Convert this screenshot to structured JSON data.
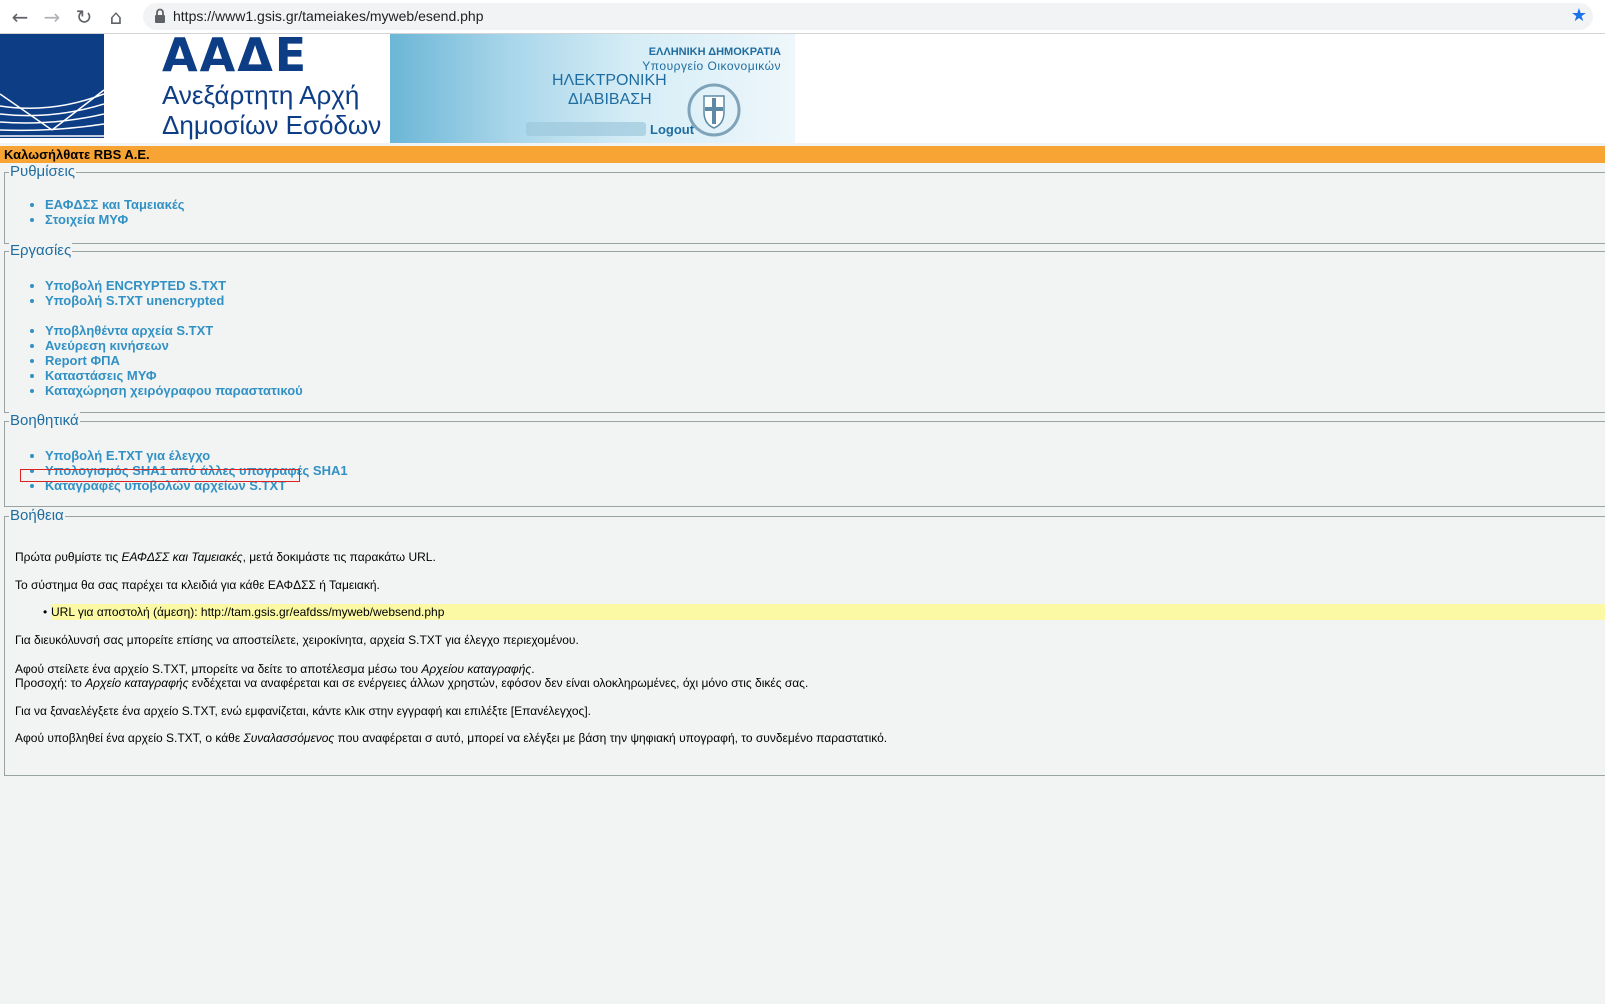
{
  "browser": {
    "url": "https://www1.gsis.gr/tameiakes/myweb/esend.php",
    "back_icon": "arrow-left-icon",
    "forward_icon": "arrow-right-icon",
    "reload_icon": "reload-icon",
    "home_icon": "home-icon",
    "lock_icon": "lock-icon",
    "bookmark_icon": "star-icon"
  },
  "header": {
    "logo_text": "ΑΑΔΕ",
    "agency_line1": "Ανεξάρτητη Αρχή",
    "agency_line2": "Δημοσίων Εσόδων",
    "republic": "ΕΛΛΗΝΙΚΗ ΔΗΜΟΚΡΑΤΙΑ",
    "ministry": "Υπουργείο Οικονομικών",
    "service_line1": "ΗΛΕΚΤΡΟΝΙΚΗ",
    "service_line2": "ΔΙΑΒΙΒΑΣΗ",
    "logout": "Logout",
    "emblem_icon": "greek-emblem-icon"
  },
  "welcome": "Καλωσήλθατε RBS A.E.",
  "settings": {
    "title": "Ρυθμίσεις",
    "items": [
      "ΕΑΦΔΣΣ και Ταμειακές",
      "Στοιχεία ΜΥΦ"
    ]
  },
  "tasks": {
    "title": "Εργασίες",
    "group1": [
      "Υποβολή ENCRYPTED S.TXT",
      "Υποβολή S.TXT unencrypted"
    ],
    "group2": [
      "Υποβληθέντα αρχεία S.TXT",
      "Ανεύρεση κινήσεων",
      "Report ΦΠΑ",
      "Καταστάσεις ΜΥΦ",
      "Καταχώρηση χειρόγραφου παραστατικού"
    ]
  },
  "tools": {
    "title": "Βοηθητικά",
    "items": [
      "Υποβολή E.TXT για έλεγχο",
      "Υπολογισμός SHA1 από άλλες υπογραφές SHA1",
      "Καταγραφές υποβολών αρχείων S.TXT"
    ]
  },
  "help": {
    "title": "Βοήθεια",
    "p1_a": "Πρώτα ρυθμίστε τις ",
    "p1_i": "ΕΑΦΔΣΣ και Ταμειακές",
    "p1_b": ", μετά δοκιμάστε τις παρακάτω URL.",
    "p2": "Το σύστημα θα σας παρέχει τα κλειδιά για κάθε ΕΑΦΔΣΣ ή Ταμειακή.",
    "url_line": "URL για αποστολή (άμεση): http://tam.gsis.gr/eafdss/myweb/websend.php",
    "p3": "Για διευκόλυνσή σας μπορείτε επίσης να αποστείλετε, χειροκίνητα, αρχεία S.TXT για έλεγχο περιεχομένου.",
    "p4_a": "Αφού στείλετε ένα αρχείο S.TXT, μπορείτε να δείτε το αποτέλεσμα μέσω του ",
    "p4_i": "Αρχείου καταγραφής",
    "p4_b": ".",
    "p5_a": "Προσοχή: το ",
    "p5_i": "Αρχείο καταγραφής",
    "p5_b": " ενδέχεται να αναφέρεται και σε ενέργειες άλλων χρηστών, εφόσον δεν είναι ολοκληρωμένες, όχι μόνο στις δικές σας.",
    "p6": "Για να ξαναελέγξετε ένα αρχείο S.TXT, ενώ εμφανίζεται, κάντε κλικ στην εγγραφή και επιλέξτε [Επανέλεγχος].",
    "p7_a": "Αφού υποβληθεί ένα αρχείο S.TXT, ο κάθε ",
    "p7_i": "Συναλασσόμενος",
    "p7_b": " που αναφέρεται σ αυτό, μπορεί να ελέγξει με βάση την ψηφιακή υπογραφή, το συνδεμένο παραστατικό."
  }
}
